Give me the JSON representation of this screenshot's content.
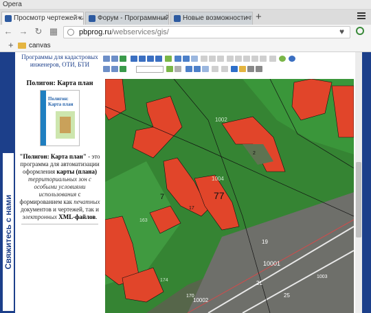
{
  "window": {
    "app_name": "Opera"
  },
  "tabs": [
    {
      "label": "Просмотр чертежей када"
    },
    {
      "label": "Форум - Программный к"
    },
    {
      "label": "Новые возможности гео"
    }
  ],
  "toolbar": {
    "url_host": "pbprog.ru",
    "url_path": "/webservices/gis/"
  },
  "bookmarks": {
    "items": [
      {
        "label": "canvas"
      }
    ]
  },
  "page": {
    "sidebar": {
      "subtitle": "Программы для кадастровых инженеров, ОТИ, БТИ",
      "product_title": "Полигон: Карта план",
      "cover_title": "Полигон: Карта план",
      "desc_name": "\"Полигон: Карта план\"",
      "desc_1": " - это программа для автоматизации оформления ",
      "desc_bold": "карты (плана)",
      "desc_italic_1": " территориальных зон с особыми условиями использования",
      "desc_2": " с формированием как ",
      "desc_italic_2": "печатных",
      "desc_3": " документов и чертежей, так и ",
      "desc_italic_3": "электронных",
      "desc_xml": " XML-файлов",
      "desc_end": "."
    },
    "contact_tab": "Свяжитесь с нами",
    "map": {
      "labels": [
        "1002",
        "1004",
        "7",
        "77",
        "17",
        "19",
        "10001",
        "10002",
        "21",
        "25",
        "1003",
        "170",
        "174",
        "163",
        "2"
      ]
    }
  }
}
